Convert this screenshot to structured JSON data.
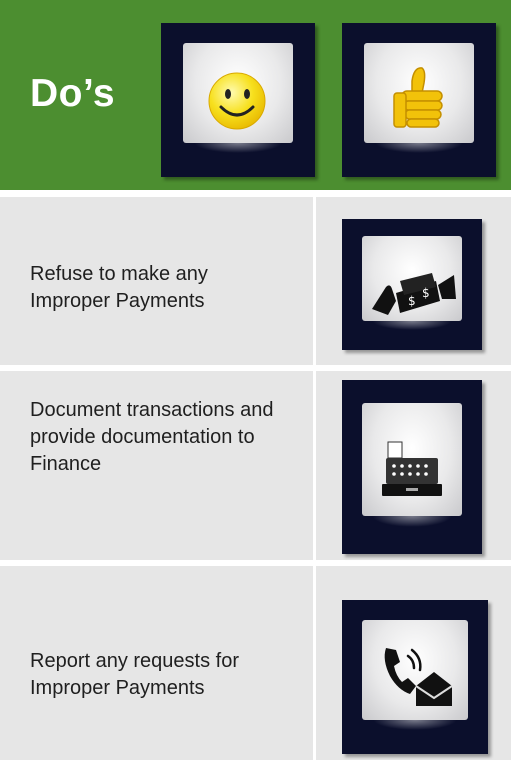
{
  "header": {
    "title": "Do’s",
    "background_color": "#4c8e30",
    "icons": [
      "smiley-face-icon",
      "thumbs-up-icon"
    ]
  },
  "rows": [
    {
      "text": "Refuse to make any Improper Payments",
      "icon": "money-handoff-icon"
    },
    {
      "text": "Document transactions and provide documentation to Finance",
      "icon": "cash-register-icon"
    },
    {
      "text": "Report any requests for Improper Payments",
      "icon": "phone-and-envelope-icon"
    }
  ],
  "colors": {
    "tile_frame": "#0b0f2c",
    "row_background": "#e6e6e6",
    "smiley": "#f7e01d",
    "thumb": "#f2c20a"
  }
}
